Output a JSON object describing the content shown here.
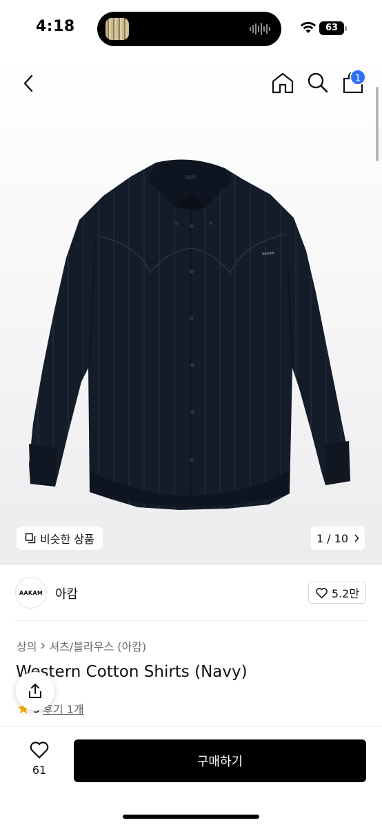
{
  "status_bar": {
    "time": "4:18",
    "battery": "63"
  },
  "nav": {
    "cart_badge": "1"
  },
  "gallery": {
    "similar_label": "비슷한 상품",
    "counter": "1 / 10",
    "shirt_tag": "AAKAM"
  },
  "brand": {
    "logo_text": "AAKAM",
    "name": "아캄",
    "likes": "5.2만"
  },
  "product": {
    "breadcrumb": [
      "상의",
      "셔츠/블라우스 (아캄)"
    ],
    "title": "Western Cotton Shirts (Navy)",
    "rating": "5",
    "review_label": "후기 1개"
  },
  "bottom_bar": {
    "wish_count": "61",
    "buy_label": "구매하기"
  },
  "colors": {
    "accent": "#2f6ff6",
    "shirt": "#141b29",
    "button": "#000000"
  }
}
